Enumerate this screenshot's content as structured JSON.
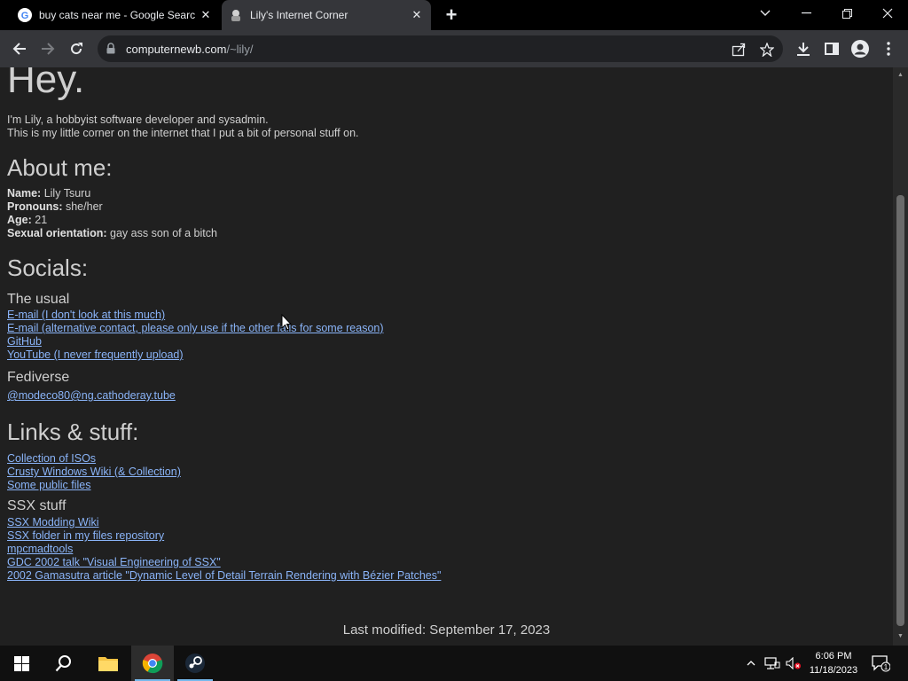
{
  "tabs": [
    {
      "title": "buy cats near me - Google Search",
      "favicon": "google-icon"
    },
    {
      "title": "Lily's Internet Corner",
      "favicon": "site-icon"
    }
  ],
  "address": {
    "domain": "computernewb.com",
    "path": "/~lily/"
  },
  "page": {
    "heading": "Hey.",
    "intro": [
      "I'm Lily, a hobbyist software developer and sysadmin.",
      "This is my little corner on the internet that I put a bit of personal stuff on."
    ],
    "about": {
      "heading": "About me:",
      "rows": [
        {
          "label": "Name:",
          "value": "Lily Tsuru"
        },
        {
          "label": "Pronouns:",
          "value": "she/her"
        },
        {
          "label": "Age:",
          "value": "21"
        },
        {
          "label": "Sexual orientation:",
          "value": "gay ass son of a bitch"
        }
      ]
    },
    "socials": {
      "heading": "Socials:",
      "usual": {
        "heading": "The usual",
        "links": [
          "E-mail (I don't look at this much)",
          "E-mail (alternative contact, please only use if the other fails for some reason)",
          "GitHub",
          "YouTube (I never frequently upload)"
        ]
      },
      "fediverse": {
        "heading": "Fediverse",
        "links": [
          "@modeco80@ng.cathoderay.tube"
        ]
      }
    },
    "links": {
      "heading": "Links & stuff:",
      "items": [
        "Collection of ISOs",
        "Crusty Windows Wiki (& Collection)",
        "Some public files"
      ]
    },
    "ssx": {
      "heading": "SSX stuff",
      "items": [
        "SSX Modding Wiki",
        "SSX folder in my files repository",
        "mpcmadtools",
        "GDC 2002 talk \"Visual Engineering of SSX\"",
        "2002 Gamasutra article \"Dynamic Level of Detail Terrain Rendering with Bézier Patches\""
      ]
    },
    "footer": "Last modified: September 17, 2023"
  },
  "taskbar": {
    "time": "6:06 PM",
    "date": "11/18/2023",
    "notification_count": "1"
  },
  "colors": {
    "link": "#8ab4f8",
    "page_bg": "#202020",
    "text": "#cfcfcf",
    "accent": "#76b9ed"
  }
}
